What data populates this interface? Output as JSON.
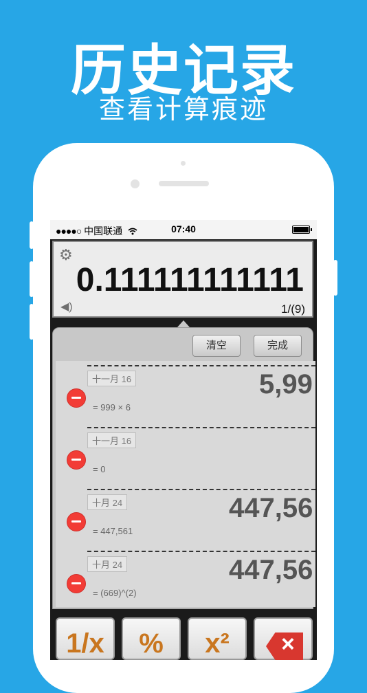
{
  "banner": {
    "title": "历史记录",
    "subtitle": "查看计算痕迹"
  },
  "status_bar": {
    "signal": "●●●●○",
    "carrier": "中国联通",
    "wifi_icon": "wifi-icon",
    "time": "07:40"
  },
  "display": {
    "value": "0.111111111111",
    "counter": "1/(9)"
  },
  "history_panel": {
    "clear_label": "清空",
    "done_label": "完成",
    "entries": [
      {
        "date": "十一月 16",
        "result": "5,99",
        "expression": "= 999 × 6"
      },
      {
        "date": "十一月 16",
        "result": "",
        "expression": "= 0"
      },
      {
        "date": "十月 24",
        "result": "447,56",
        "expression": "= 447,561"
      },
      {
        "date": "十月 24",
        "result": "447,56",
        "expression": "= (669)^(2)"
      }
    ]
  },
  "keys": {
    "reciprocal": "1/x",
    "percent": "%",
    "square": "x²",
    "backspace_icon": "backspace-icon"
  },
  "colors": {
    "background": "#27a6e6",
    "delete": "#f23c36",
    "key_text": "#c9761f"
  }
}
